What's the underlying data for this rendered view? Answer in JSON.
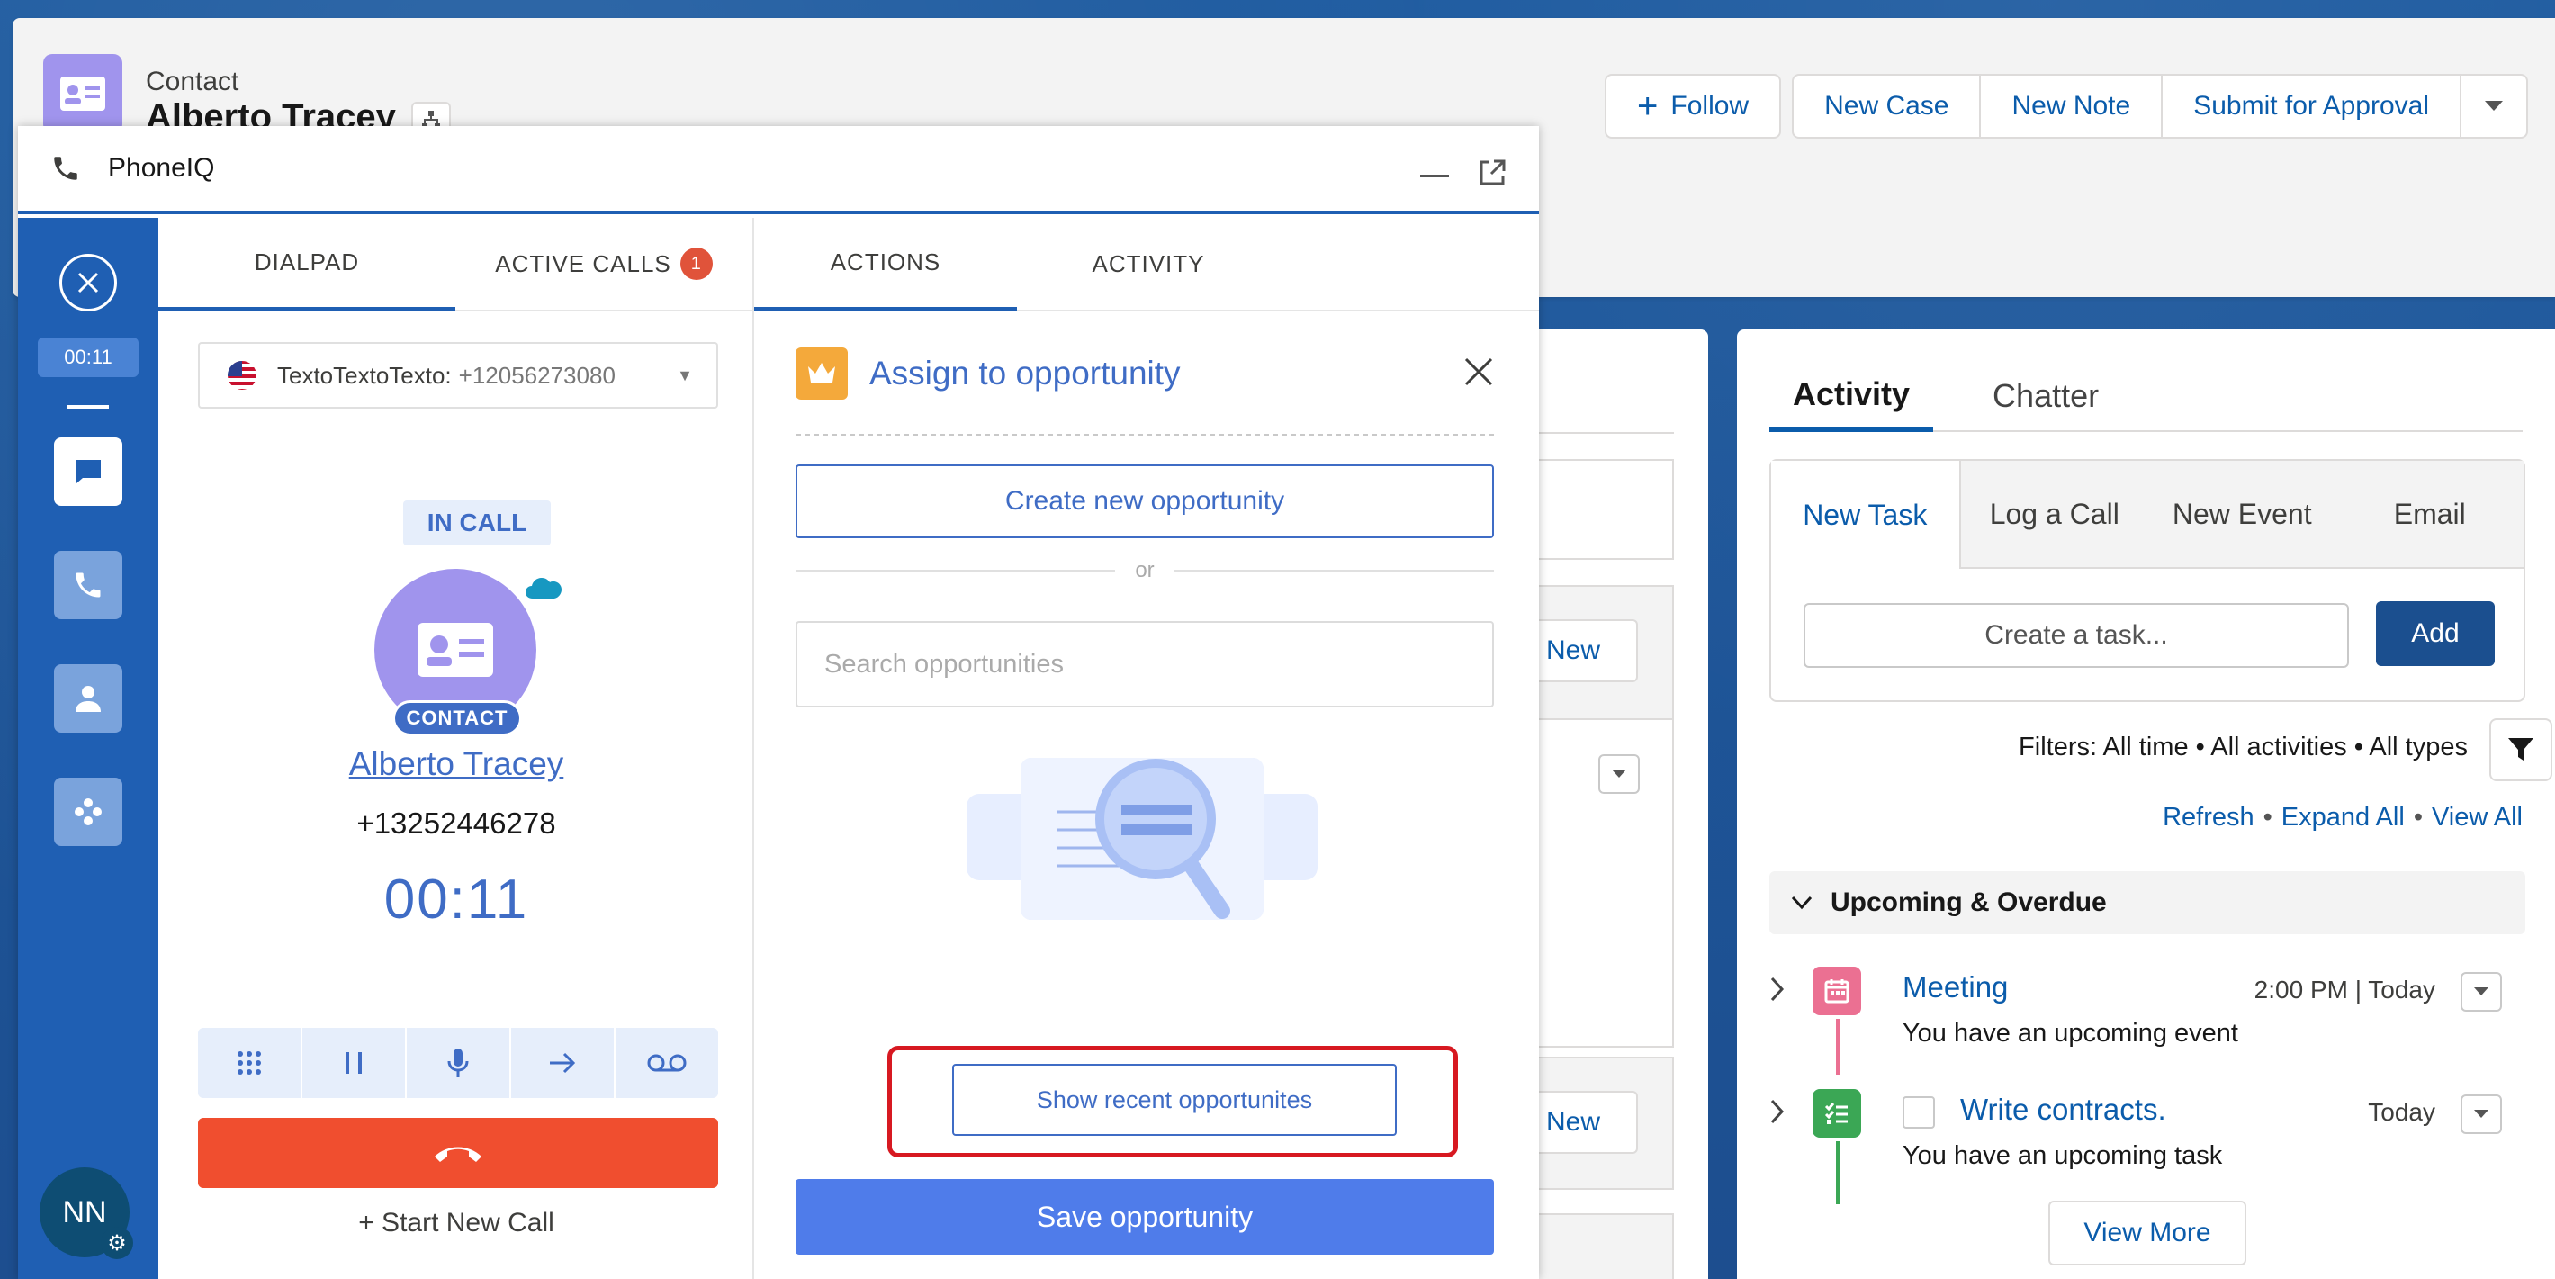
{
  "record": {
    "type": "Contact",
    "name": "Alberto Tracey",
    "actions": [
      "Follow",
      "New Case",
      "New Note",
      "Submit for Approval"
    ]
  },
  "phoneiq": {
    "title": "PhoneIQ",
    "rail": {
      "timer": "00:11",
      "avatar_initials": "NN"
    },
    "dialpad": {
      "tabs": [
        "DIALPAD",
        "ACTIVE CALLS"
      ],
      "active_calls_count": "1",
      "caller_id_label": "TextoTextoTexto:",
      "caller_id_number": "+12056273080",
      "status": "IN CALL",
      "record_pill": "CONTACT",
      "contact_name": "Alberto Tracey",
      "contact_phone": "+13252446278",
      "call_timer": "00:11",
      "start_new_call": "+ Start New Call"
    },
    "actions": {
      "tabs": [
        "ACTIONS",
        "ACTIVITY"
      ],
      "title": "Assign to opportunity",
      "create_label": "Create new opportunity",
      "or_label": "or",
      "search_placeholder": "Search opportunities",
      "show_recent_label": "Show recent opportunites",
      "save_label": "Save opportunity"
    }
  },
  "middle": {
    "new_label_1": "New",
    "new_label_2": "New"
  },
  "activity": {
    "tabs": [
      "Activity",
      "Chatter"
    ],
    "composer_tabs": [
      "New Task",
      "Log a Call",
      "New Event",
      "Email"
    ],
    "task_placeholder": "Create a task...",
    "add_label": "Add",
    "filters": "Filters: All time • All activities • All types",
    "links": [
      "Refresh",
      "Expand All",
      "View All"
    ],
    "section": "Upcoming & Overdue",
    "items": [
      {
        "title": "Meeting",
        "time": "2:00 PM | Today",
        "sub": "You have an upcoming event"
      },
      {
        "title": "Write contracts.",
        "time": "Today",
        "sub": "You have an upcoming task"
      }
    ],
    "view_more": "View More"
  },
  "colors": {
    "brand_blue": "#1f5fb3",
    "accent": "#3f6cc5",
    "hangup": "#f04e2f",
    "highlight": "#d71921"
  }
}
